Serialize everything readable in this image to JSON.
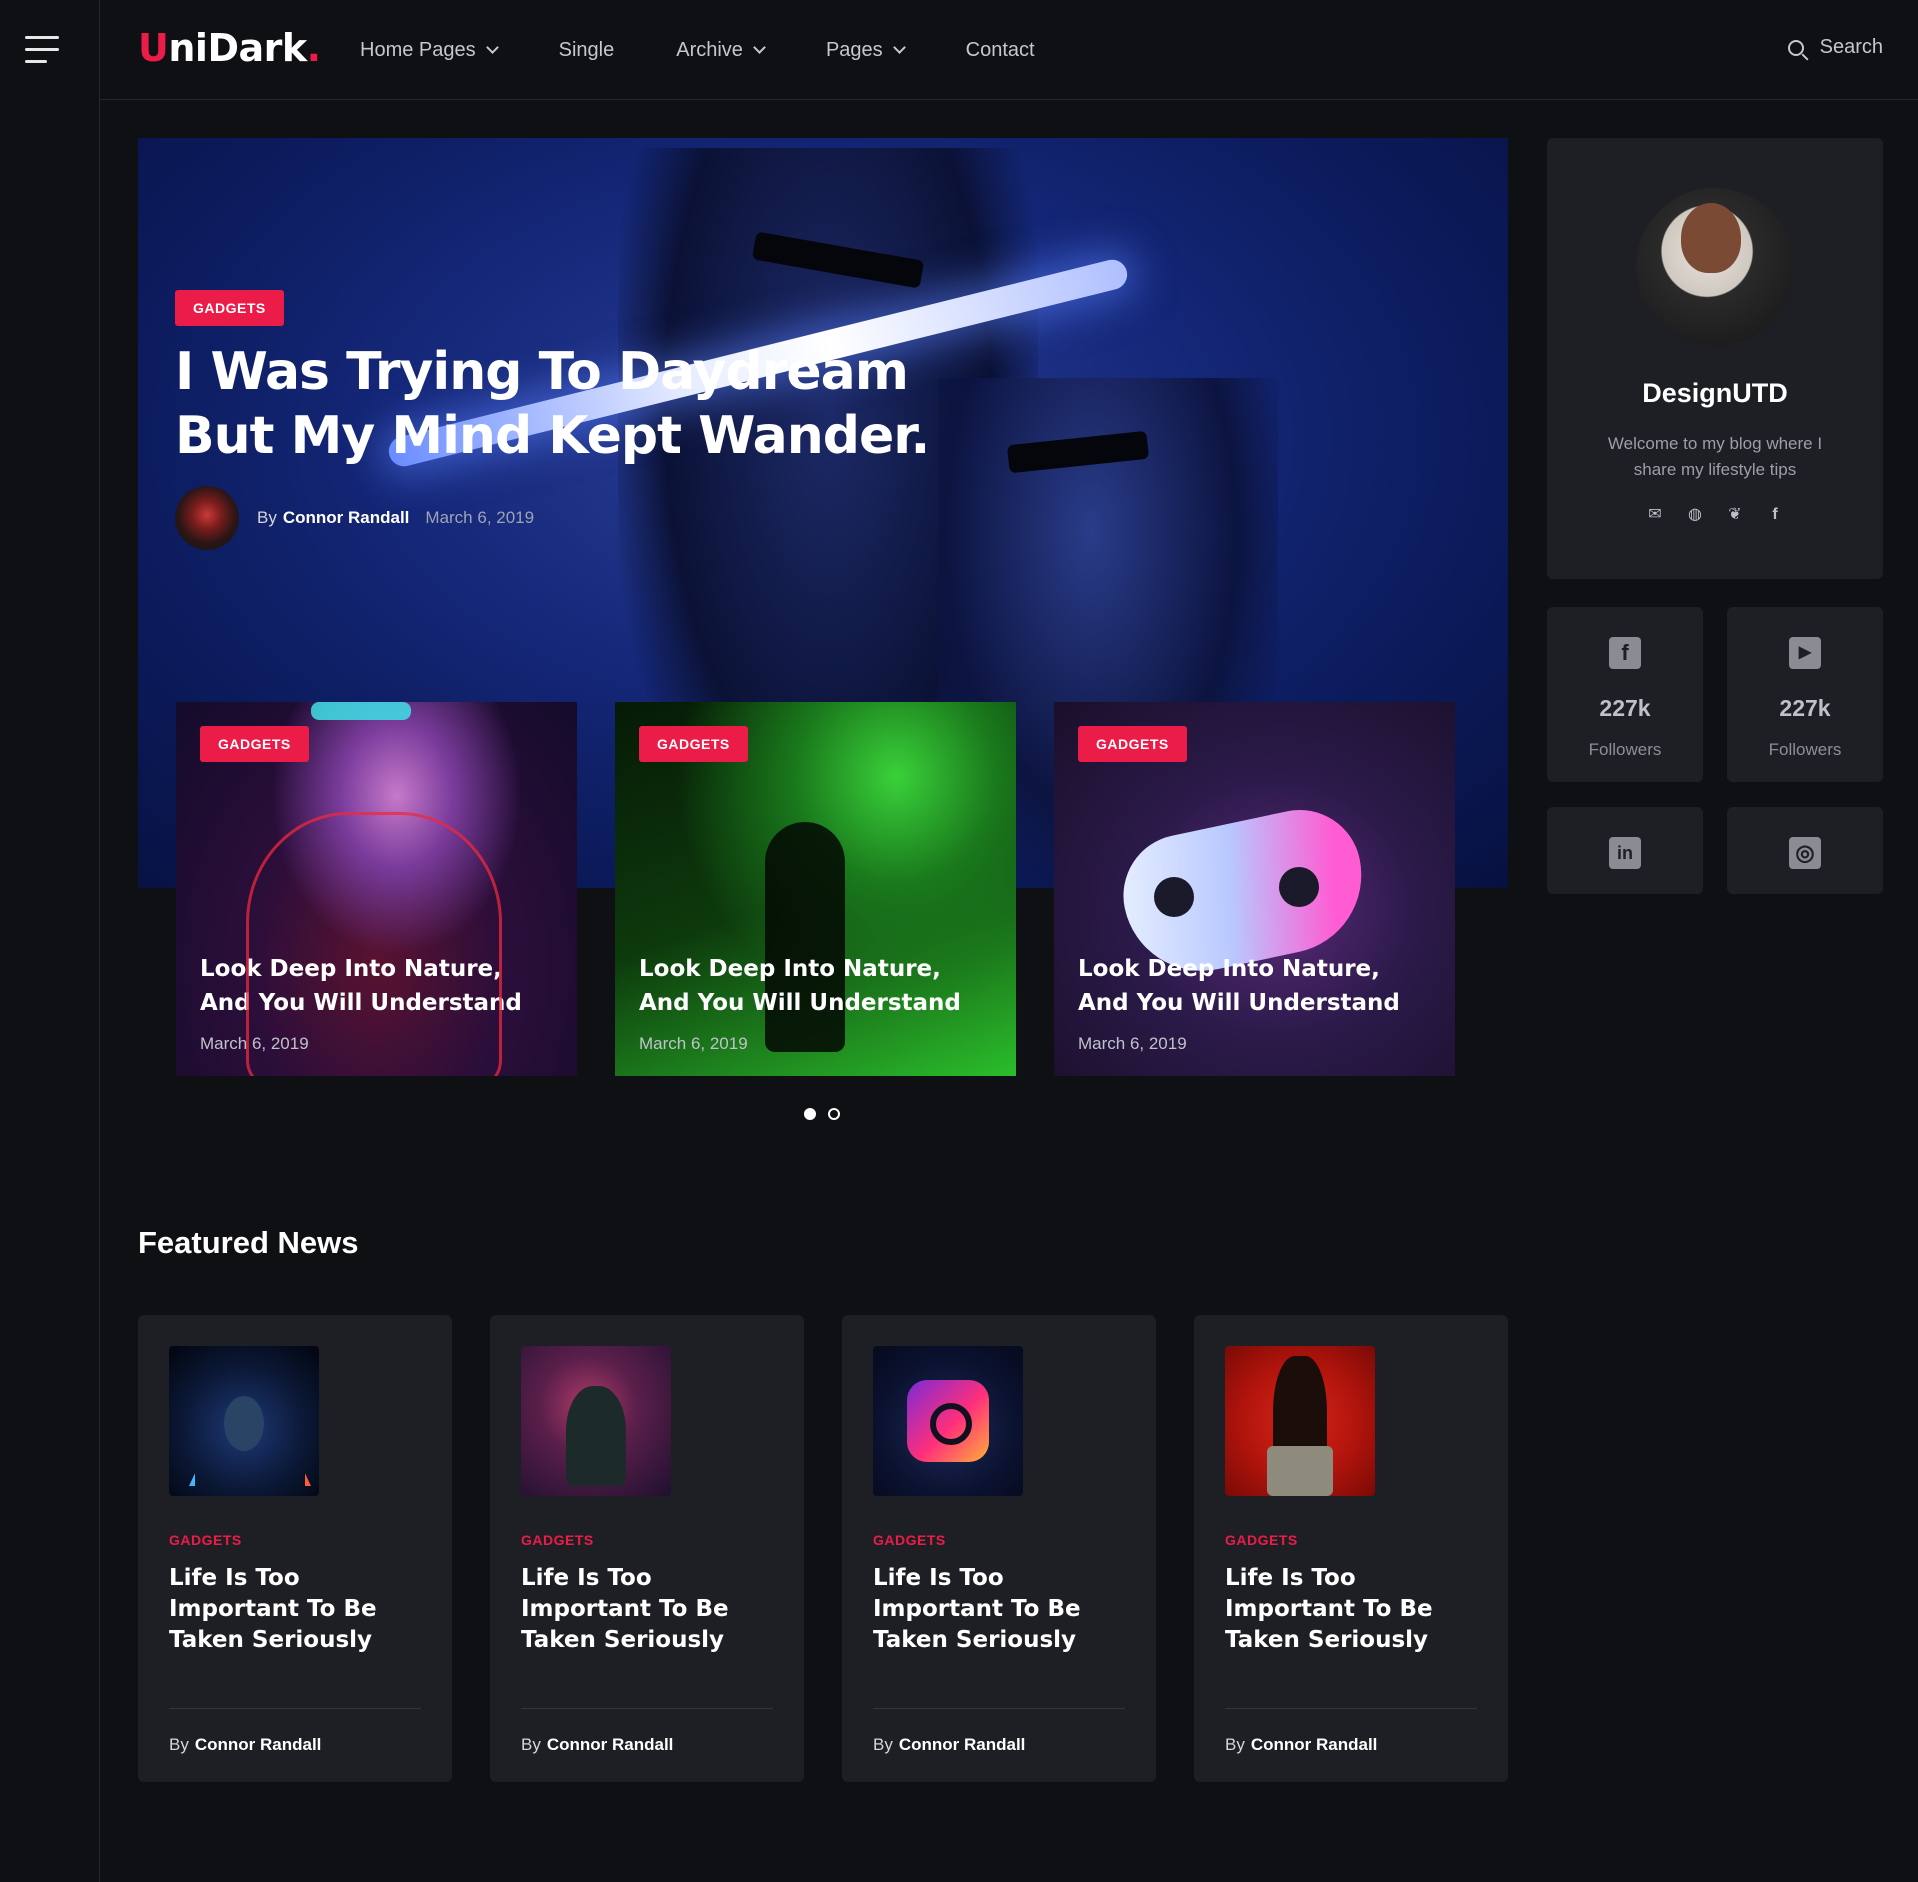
{
  "brand": {
    "logo_u": "U",
    "logo_rest": "niDark",
    "logo_dot": ".",
    "accent": "#ec1c48"
  },
  "nav": {
    "items": [
      {
        "label": "Home Pages",
        "dropdown": true
      },
      {
        "label": "Single",
        "dropdown": false
      },
      {
        "label": "Archive",
        "dropdown": true
      },
      {
        "label": "Pages",
        "dropdown": true
      },
      {
        "label": "Contact",
        "dropdown": false
      }
    ],
    "search_label": "Search"
  },
  "hero": {
    "badge": "GADGETS",
    "title": "I Was Trying To Daydream But My Mind Kept Wander.",
    "by": "By",
    "author": "Connor Randall",
    "date": "March 6, 2019"
  },
  "slider": {
    "slides": [
      {
        "badge": "GADGETS",
        "title": "Look Deep Into Nature, And You Will Understand",
        "date": "March 6, 2019"
      },
      {
        "badge": "GADGETS",
        "title": "Look Deep Into Nature, And You Will Understand",
        "date": "March 6, 2019"
      },
      {
        "badge": "GADGETS",
        "title": "Look Deep Into Nature, And You Will Understand",
        "date": "March 6, 2019"
      }
    ],
    "pages": 2,
    "active_page": 1
  },
  "profile": {
    "name": "DesignUTD",
    "bio": "Welcome to my blog where I share my lifestyle tips",
    "social": [
      "mail-icon",
      "globe-icon",
      "twitter-icon",
      "facebook-icon"
    ]
  },
  "stats": [
    {
      "icon": "facebook-icon",
      "glyph": "f",
      "count": "227k",
      "label": "Followers"
    },
    {
      "icon": "youtube-icon",
      "glyph": "▶",
      "count": "227k",
      "label": "Followers"
    },
    {
      "icon": "linkedin-icon",
      "glyph": "in",
      "count": "",
      "label": ""
    },
    {
      "icon": "instagram-icon",
      "glyph": "◎",
      "count": "",
      "label": ""
    }
  ],
  "featured": {
    "title": "Featured News",
    "cards": [
      {
        "category": "GADGETS",
        "title": "Life Is Too Important To Be Taken Seriously",
        "by": "By",
        "author": "Connor Randall"
      },
      {
        "category": "GADGETS",
        "title": "Life Is Too Important To Be Taken Seriously",
        "by": "By",
        "author": "Connor Randall"
      },
      {
        "category": "GADGETS",
        "title": "Life Is Too Important To Be Taken Seriously",
        "by": "By",
        "author": "Connor Randall"
      },
      {
        "category": "GADGETS",
        "title": "Life Is Too Important To Be Taken Seriously",
        "by": "By",
        "author": "Connor Randall"
      }
    ]
  }
}
